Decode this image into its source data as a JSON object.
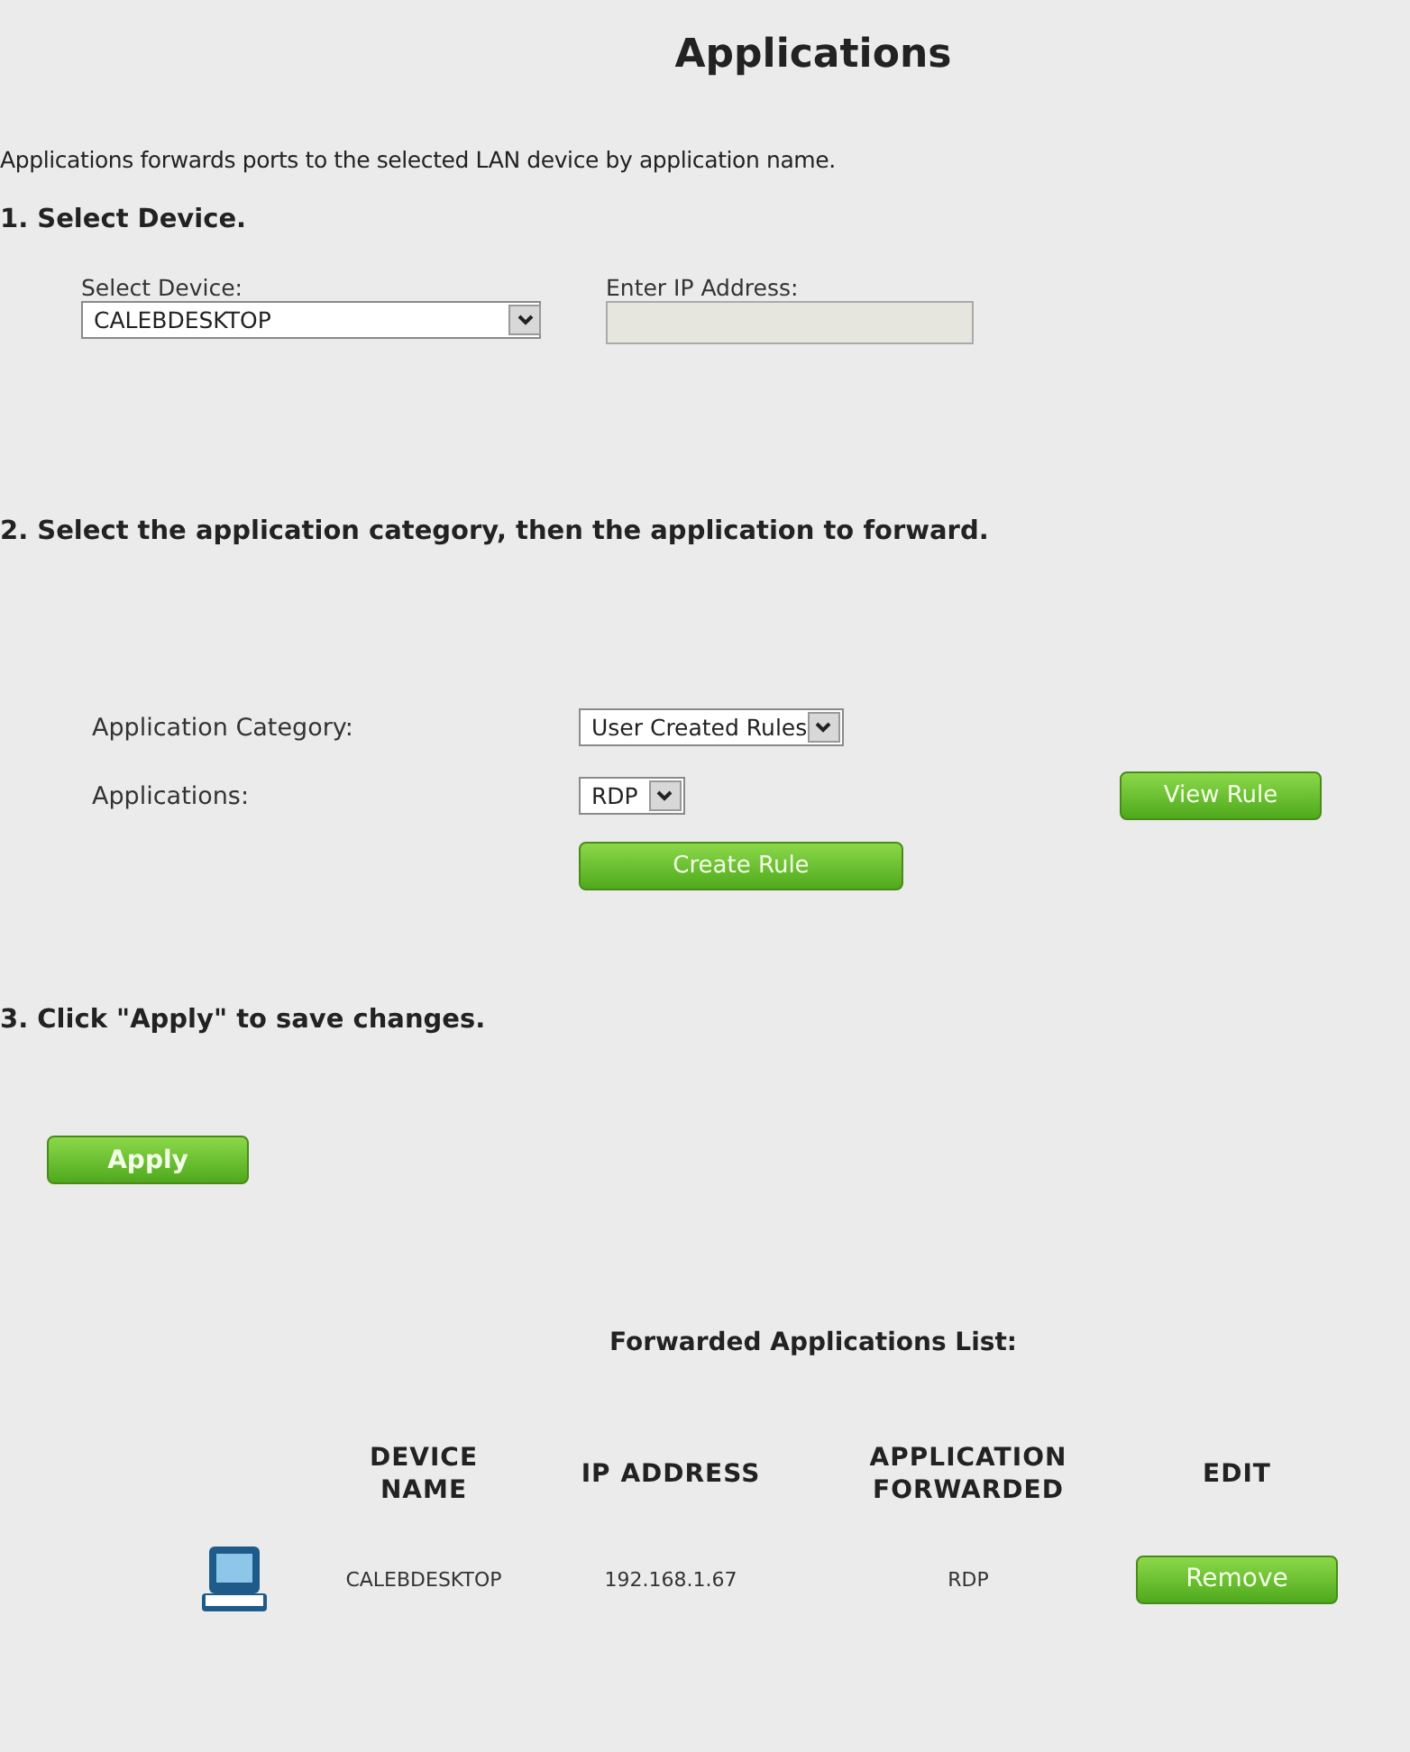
{
  "title": "Applications",
  "description": "Applications forwards ports to the selected LAN device by application name.",
  "step1": {
    "heading": "1. Select Device.",
    "device_label": "Select Device:",
    "device_value": "CALEBDESKTOP",
    "ip_label": "Enter IP Address:",
    "ip_disabled": true
  },
  "step2": {
    "heading": "2. Select the application category, then the application to forward.",
    "category_label": "Application Category:",
    "category_value": "User Created Rules",
    "applications_label": "Applications:",
    "applications_value": "RDP",
    "view_button": "View Rule",
    "create_button": "Create Rule"
  },
  "step3": {
    "heading": "3. Click \"Apply\" to save changes.",
    "apply_button": "Apply"
  },
  "list": {
    "heading": "Forwarded Applications List:",
    "columns": [
      "DEVICE NAME",
      "IP ADDRESS",
      "APPLICATION FORWARDED",
      "EDIT"
    ],
    "rows": [
      {
        "device": "CALEBDESKTOP",
        "ip": "192.168.1.67",
        "application": "RDP",
        "action": "Remove"
      }
    ]
  }
}
